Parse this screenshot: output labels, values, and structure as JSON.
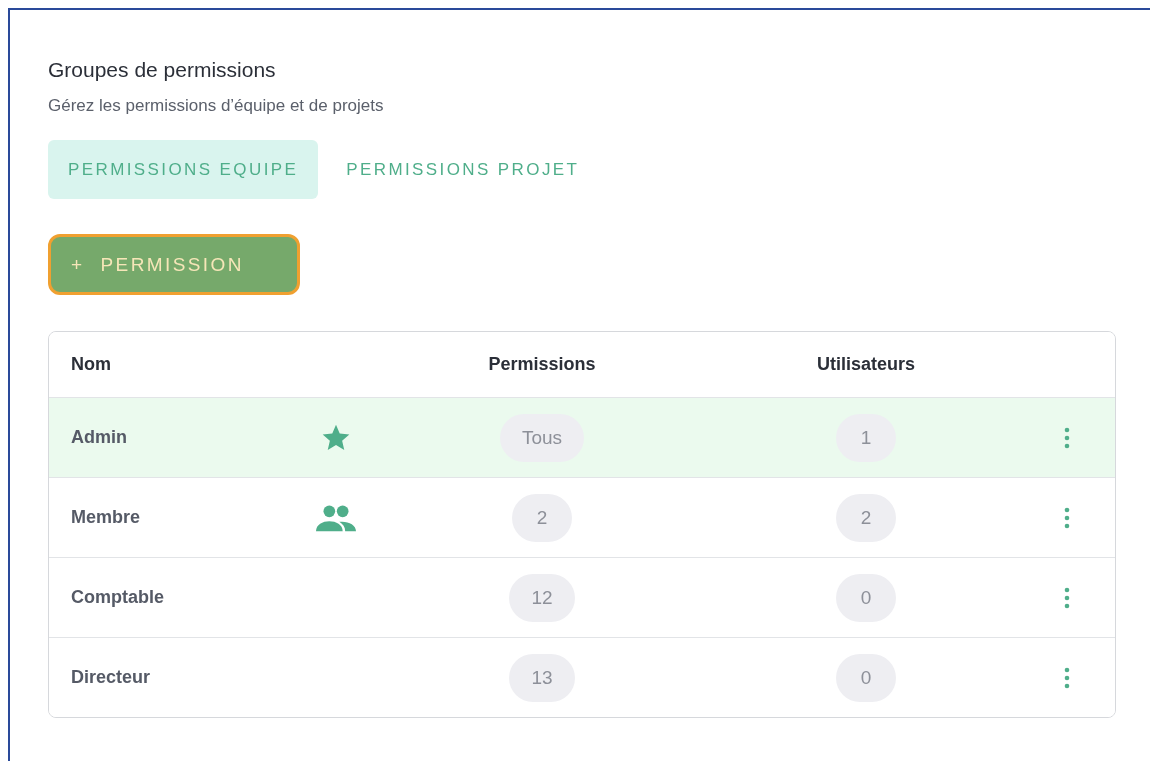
{
  "panel": {
    "title": "Groupes de permissions",
    "subtitle": "Gérez les permissions d’équipe et de projets"
  },
  "tabs": [
    {
      "label": "PERMISSIONS EQUIPE",
      "selected": true
    },
    {
      "label": "PERMISSIONS PROJET",
      "selected": false
    }
  ],
  "add_button": {
    "icon": "+",
    "label": "PERMISSION",
    "focused": true
  },
  "table": {
    "columns": [
      "Nom",
      "Permissions",
      "Utilisateurs"
    ],
    "rows": [
      {
        "name": "Admin",
        "kind": "star",
        "permissions": "Tous",
        "users": "1",
        "selected": true
      },
      {
        "name": "Membre",
        "kind": "group",
        "permissions": "2",
        "users": "2",
        "selected": false
      },
      {
        "name": "Comptable",
        "kind": "plain",
        "permissions": "12",
        "users": "0",
        "selected": false
      },
      {
        "name": "Directeur",
        "kind": "plain",
        "permissions": "13",
        "users": "0",
        "selected": false
      }
    ]
  }
}
